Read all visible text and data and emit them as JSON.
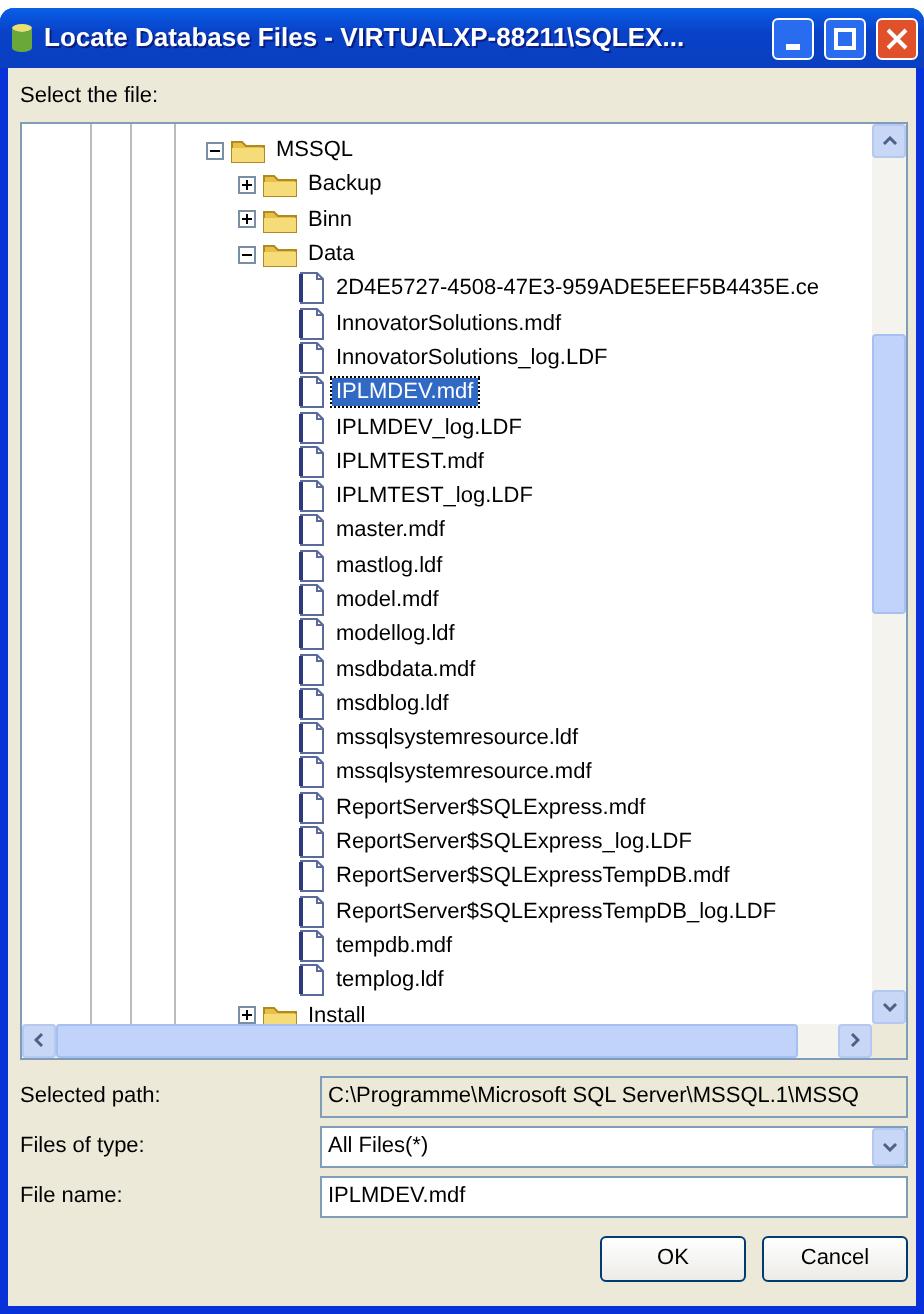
{
  "window": {
    "title": "Locate Database Files - VIRTUALXP-88211\\SQLEX..."
  },
  "tree_label": "Select the file:",
  "tree": [
    {
      "label": "MSSQL",
      "kind": "folder",
      "expanded": true,
      "selected": false,
      "children": [
        {
          "label": "Backup",
          "kind": "folder",
          "expanded": false,
          "selected": false
        },
        {
          "label": "Binn",
          "kind": "folder",
          "expanded": false,
          "selected": false
        },
        {
          "label": "Data",
          "kind": "folder",
          "expanded": true,
          "selected": false,
          "children": [
            {
              "label": "2D4E5727-4508-47E3-959ADE5EEF5B4435E.ce",
              "kind": "file",
              "selected": false
            },
            {
              "label": "InnovatorSolutions.mdf",
              "kind": "file",
              "selected": false
            },
            {
              "label": "InnovatorSolutions_log.LDF",
              "kind": "file",
              "selected": false
            },
            {
              "label": "IPLMDEV.mdf",
              "kind": "file",
              "selected": true
            },
            {
              "label": "IPLMDEV_log.LDF",
              "kind": "file",
              "selected": false
            },
            {
              "label": "IPLMTEST.mdf",
              "kind": "file",
              "selected": false
            },
            {
              "label": "IPLMTEST_log.LDF",
              "kind": "file",
              "selected": false
            },
            {
              "label": "master.mdf",
              "kind": "file",
              "selected": false
            },
            {
              "label": "mastlog.ldf",
              "kind": "file",
              "selected": false
            },
            {
              "label": "model.mdf",
              "kind": "file",
              "selected": false
            },
            {
              "label": "modellog.ldf",
              "kind": "file",
              "selected": false
            },
            {
              "label": "msdbdata.mdf",
              "kind": "file",
              "selected": false
            },
            {
              "label": "msdblog.ldf",
              "kind": "file",
              "selected": false
            },
            {
              "label": "mssqlsystemresource.ldf",
              "kind": "file",
              "selected": false
            },
            {
              "label": "mssqlsystemresource.mdf",
              "kind": "file",
              "selected": false
            },
            {
              "label": "ReportServer$SQLExpress.mdf",
              "kind": "file",
              "selected": false
            },
            {
              "label": "ReportServer$SQLExpress_log.LDF",
              "kind": "file",
              "selected": false
            },
            {
              "label": "ReportServer$SQLExpressTempDB.mdf",
              "kind": "file",
              "selected": false
            },
            {
              "label": "ReportServer$SQLExpressTempDB_log.LDF",
              "kind": "file",
              "selected": false
            },
            {
              "label": "tempdb.mdf",
              "kind": "file",
              "selected": false
            },
            {
              "label": "templog.ldf",
              "kind": "file",
              "selected": false
            }
          ]
        },
        {
          "label": "Install",
          "kind": "folder",
          "expanded": false,
          "selected": false
        }
      ]
    }
  ],
  "selected_path": {
    "label": "Selected path:",
    "value": "C:\\Programme\\Microsoft SQL Server\\MSSQL.1\\MSSQ"
  },
  "file_type": {
    "label": "Files of type:",
    "value": "All Files(*)"
  },
  "file_name": {
    "label": "File name:",
    "value": "IPLMDEV.mdf"
  },
  "buttons": [
    "OK",
    "Cancel"
  ]
}
